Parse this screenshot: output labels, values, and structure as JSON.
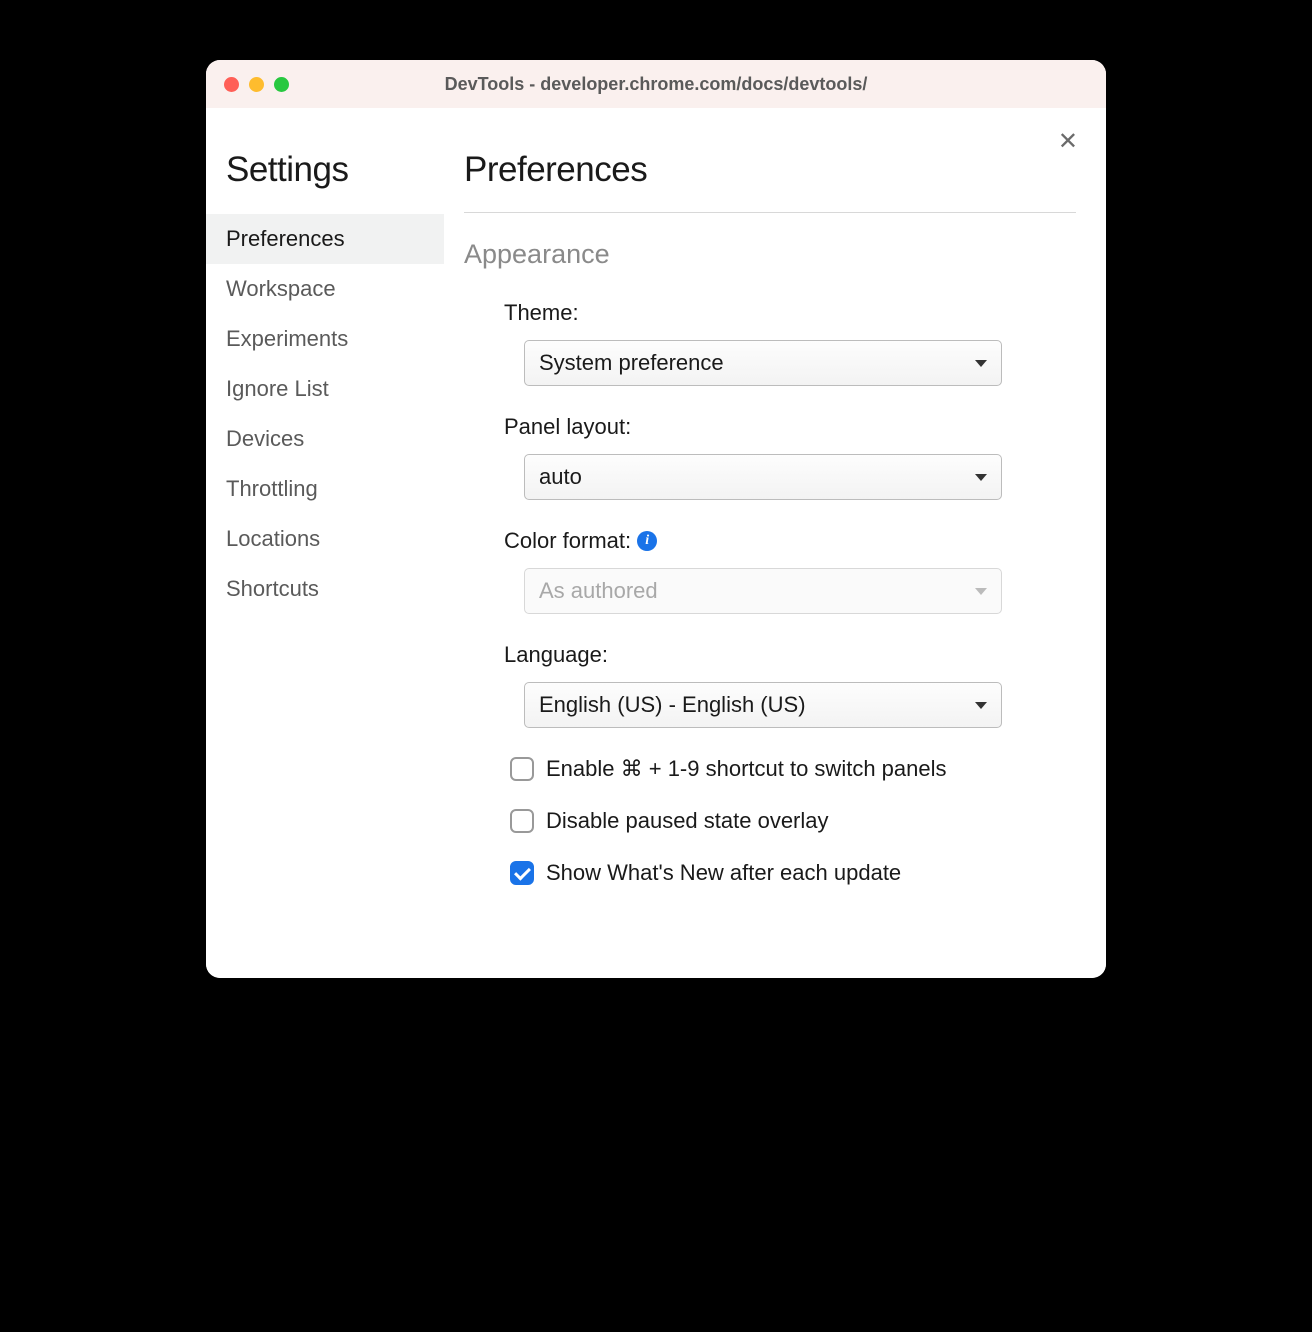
{
  "window": {
    "title": "DevTools - developer.chrome.com/docs/devtools/"
  },
  "sidebar": {
    "title": "Settings",
    "items": [
      {
        "label": "Preferences",
        "active": true
      },
      {
        "label": "Workspace",
        "active": false
      },
      {
        "label": "Experiments",
        "active": false
      },
      {
        "label": "Ignore List",
        "active": false
      },
      {
        "label": "Devices",
        "active": false
      },
      {
        "label": "Throttling",
        "active": false
      },
      {
        "label": "Locations",
        "active": false
      },
      {
        "label": "Shortcuts",
        "active": false
      }
    ]
  },
  "main": {
    "title": "Preferences",
    "section": "Appearance",
    "fields": {
      "theme": {
        "label": "Theme:",
        "value": "System preference"
      },
      "panel_layout": {
        "label": "Panel layout:",
        "value": "auto"
      },
      "color_format": {
        "label": "Color format:",
        "value": "As authored",
        "disabled": true,
        "info": true
      },
      "language": {
        "label": "Language:",
        "value": "English (US) - English (US)"
      }
    },
    "checkboxes": [
      {
        "label": "Enable ⌘ + 1-9 shortcut to switch panels",
        "checked": false
      },
      {
        "label": "Disable paused state overlay",
        "checked": false
      },
      {
        "label": "Show What's New after each update",
        "checked": true
      }
    ]
  }
}
